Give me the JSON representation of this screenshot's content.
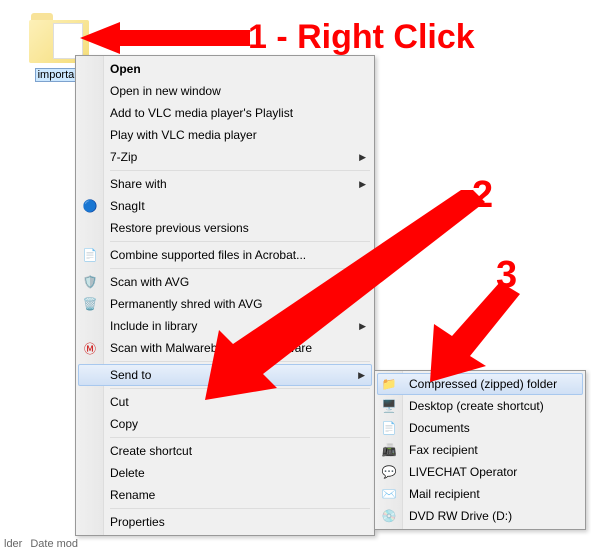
{
  "folder": {
    "label": "importan"
  },
  "main_menu": {
    "items": [
      {
        "label": "Open",
        "bold": true
      },
      {
        "label": "Open in new window"
      },
      {
        "label": "Add to VLC media player's Playlist"
      },
      {
        "label": "Play with VLC media player"
      },
      {
        "label": "7-Zip",
        "submenu": true
      },
      {
        "sep": true
      },
      {
        "label": "Share with",
        "submenu": true
      },
      {
        "label": "SnagIt",
        "icon": "snagit"
      },
      {
        "label": "Restore previous versions"
      },
      {
        "sep": true
      },
      {
        "label": "Combine supported files in Acrobat...",
        "icon": "acrobat"
      },
      {
        "sep": true
      },
      {
        "label": "Scan with AVG",
        "icon": "avg"
      },
      {
        "label": "Permanently shred with AVG",
        "icon": "shred"
      },
      {
        "label": "Include in library",
        "submenu": true
      },
      {
        "label": "Scan with Malwarebytes Anti-Malware",
        "icon": "malwarebytes"
      },
      {
        "sep": true
      },
      {
        "label": "Send to",
        "submenu": true,
        "highlight": true
      },
      {
        "sep": true
      },
      {
        "label": "Cut"
      },
      {
        "label": "Copy"
      },
      {
        "sep": true
      },
      {
        "label": "Create shortcut"
      },
      {
        "label": "Delete"
      },
      {
        "label": "Rename"
      },
      {
        "sep": true
      },
      {
        "label": "Properties"
      }
    ]
  },
  "sub_menu": {
    "items": [
      {
        "label": "Compressed (zipped) folder",
        "icon": "zip",
        "highlight": true
      },
      {
        "label": "Desktop (create shortcut)",
        "icon": "desktop"
      },
      {
        "label": "Documents",
        "icon": "documents"
      },
      {
        "label": "Fax recipient",
        "icon": "fax"
      },
      {
        "label": "LIVECHAT Operator",
        "icon": "livechat"
      },
      {
        "label": "Mail recipient",
        "icon": "mail"
      },
      {
        "label": "DVD RW Drive (D:)",
        "icon": "dvd"
      }
    ]
  },
  "annotations": {
    "step1": "1 - Right Click",
    "step2": "2",
    "step3": "3"
  },
  "status": {
    "prefix": "lder",
    "date_label": "Date mod"
  }
}
